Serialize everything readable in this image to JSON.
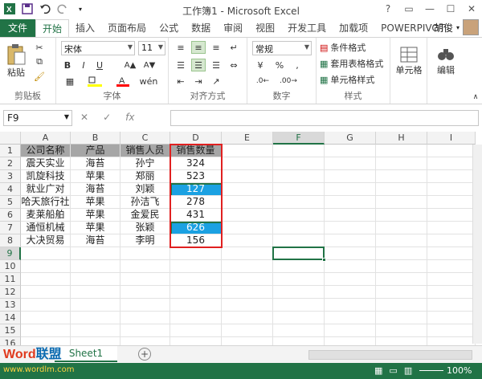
{
  "window": {
    "title": "工作簿1 - Microsoft Excel"
  },
  "tabs": [
    "文件",
    "开始",
    "插入",
    "页面布局",
    "公式",
    "数据",
    "审阅",
    "视图",
    "开发工具",
    "加载项",
    "POWERPIVOT"
  ],
  "user": "胡俊",
  "ribbon": {
    "paste": "粘贴",
    "clipboard": "剪贴板",
    "font_name": "宋体",
    "font_size": "11",
    "font_group": "字体",
    "bold": "B",
    "italic": "I",
    "underline": "U",
    "align_group": "对齐方式",
    "number_format": "常规",
    "percent": "%",
    "comma": ",",
    "number_group": "数字",
    "cond_format": "条件格式",
    "table_format": "套用表格格式",
    "cell_style": "单元格样式",
    "style_group": "样式",
    "cells": "单元格",
    "edit": "编辑"
  },
  "formula_bar": {
    "name_box": "F9",
    "fx": "fx",
    "value": ""
  },
  "columns": [
    "A",
    "B",
    "C",
    "D",
    "E",
    "F",
    "G",
    "H",
    "I"
  ],
  "rows": [
    [
      "公司名称",
      "产品",
      "销售人员",
      "销售数量"
    ],
    [
      "震天实业",
      "海苔",
      "孙宁",
      "324"
    ],
    [
      "凯旋科技",
      "苹果",
      "郑丽",
      "523"
    ],
    [
      "就业广对",
      "海苔",
      "刘颖",
      "127"
    ],
    [
      "哈天旅行社",
      "苹果",
      "孙洁飞",
      "278"
    ],
    [
      "麦莱船舶",
      "苹果",
      "金爱民",
      "431"
    ],
    [
      "通恒机械",
      "苹果",
      "张颖",
      "626"
    ],
    [
      "大决贸易",
      "海苔",
      "李明",
      "156"
    ]
  ],
  "row_numbers": [
    "1",
    "2",
    "3",
    "4",
    "5",
    "6",
    "7",
    "8",
    "9",
    "10",
    "11",
    "12",
    "13",
    "14",
    "15",
    "16"
  ],
  "highlight_color": "#1ba1e2",
  "header_fill": "#a6a6a6",
  "accent": "#217346",
  "sheet_tab": "Sheet1",
  "status": {
    "zoom": "100%"
  },
  "watermark": {
    "brand": "Word联盟",
    "url": "www.wordlm.com"
  }
}
